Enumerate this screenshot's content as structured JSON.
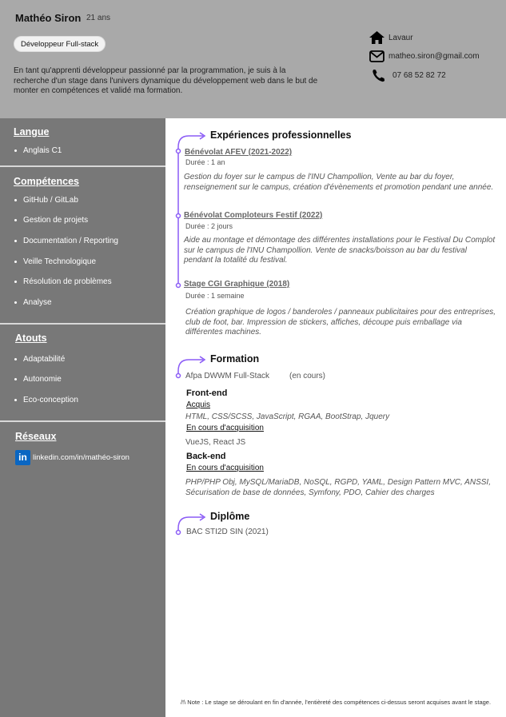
{
  "header": {
    "name": "Mathéo Siron",
    "age": "21 ans",
    "job": "Développeur Full-stack",
    "intro": "En tant qu'apprenti développeur passionné par la programmation, je suis à la recherche d'un stage dans l'univers dynamique du développement web dans le but de monter en compétences et validé ma formation.",
    "contact": {
      "city": "Lavaur",
      "email": "matheo.siron@gmail.com",
      "phone": "07 68 52 82 72"
    }
  },
  "sidebar": {
    "langue": {
      "title": "Langue",
      "items": [
        "Anglais C1"
      ]
    },
    "competences": {
      "title": "Compétences",
      "items": [
        "GitHub / GitLab",
        "Gestion de projets",
        "Documentation / Reporting",
        "Veille Technologique",
        "Résolution de problèmes",
        "Analyse"
      ]
    },
    "atouts": {
      "title": "Atouts",
      "items": [
        "Adaptabilité",
        "Autonomie",
        "Eco-conception"
      ]
    },
    "reseaux": {
      "title": "Réseaux",
      "linkedin_icon": "in",
      "linkedin": "linkedin.com/in/mathéo-siron"
    }
  },
  "experiences": {
    "title": "Expériences professionnelles",
    "items": [
      {
        "title": "Bénévolat AFEV   (2021-2022)",
        "duration": "Durée : 1 an",
        "desc": "Gestion du foyer sur le campus de l'INU Champollion, Vente au bar du foyer, renseignement sur le campus, création d'évènements et promotion pendant une année."
      },
      {
        "title": "Bénévolat Comploteurs Festif   (2022)",
        "duration": "Durée : 2 jours",
        "desc": "Aide au montage et démontage des différentes installations pour le Festival Du Complot sur le campus de l'INU Champollion. Vente de snacks/boisson au bar du festival pendant la totalité du festival."
      },
      {
        "title": "Stage CGI Graphique   (2018)",
        "duration": "Durée : 1 semaine",
        "desc": "Création graphique de logos / banderoles / panneaux publicitaires pour des entreprises, club de foot, bar. Impression de stickers, affiches, découpe puis emballage via différentes machines."
      }
    ]
  },
  "formation": {
    "title": "Formation",
    "school": "Afpa DWWM Full-Stack",
    "status": "(en cours)",
    "frontend": {
      "title": "Front-end",
      "acquis_label": "Acquis",
      "acquis": "HTML, CSS/SCSS, JavaScript, RGAA, BootStrap, Jquery",
      "en_cours_label": "En cours d'acquisition",
      "en_cours": "VueJS, React JS"
    },
    "backend": {
      "title": "Back-end",
      "en_cours_label": "En cours d'acquisition",
      "en_cours": "PHP/PHP Obj, MySQL/MariaDB, NoSQL, RGPD, YAML, Design Pattern MVC, ANSSI, Sécurisation de base de données, Symfony, PDO, Cahier des charges"
    }
  },
  "diplome": {
    "title": "Diplôme",
    "item": "BAC STI2D SIN (2021)"
  },
  "note": "/!\\ Note : Le stage se déroulant en fin d'année, l'entièreté des compétences ci-dessus seront acquises avant le stage.",
  "colors": {
    "accent": "#8b5cf6",
    "header_bg": "#a9a9a9",
    "sidebar_bg": "#787878"
  }
}
